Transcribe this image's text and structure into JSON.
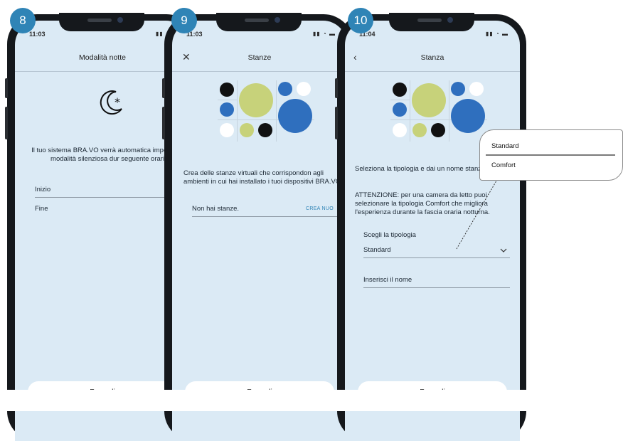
{
  "steps": {
    "one": "8",
    "two": "9",
    "three": "10"
  },
  "screen1": {
    "time": "11:03",
    "title": "Modalità notte",
    "description": "Il tuo sistema BRA.VO verrà automatica impostato in modalità silenziosa dur seguente orario.",
    "start_label": "Inizio",
    "end_label": "Fine",
    "proceed_label": "Procedi"
  },
  "screen2": {
    "time": "11:03",
    "title": "Stanze",
    "description": "Crea delle stanze virtuali che corrispondon agli ambienti in cui hai installato i tuoi dispositivi BRA.VO.",
    "no_rooms": "Non hai stanze.",
    "create_link": "CREA NUO",
    "proceed_label": "Procedi"
  },
  "screen3": {
    "time": "11:04",
    "title": "Stanza",
    "intro": "Seleziona la tipologia e dai un nome stanza.",
    "warning": "ATTENZIONE: per una camera da letto puoi selezionare la tipologia Comfort che migliora l'esperienza durante la fascia oraria notturna.",
    "type_label": "Scegli la tipologia",
    "type_value": "Standard",
    "name_placeholder": "Inserisci il nome",
    "proceed_label": "Procedi"
  },
  "dropdown_popup": {
    "options": [
      "Standard",
      "Comfort"
    ]
  },
  "illustration_colors": {
    "black": "#111111",
    "olive": "#c7d27a",
    "blue": "#2f6fbe",
    "white": "#ffffff",
    "divider": "#c6d3de"
  },
  "accent_color": "#2f84b6"
}
